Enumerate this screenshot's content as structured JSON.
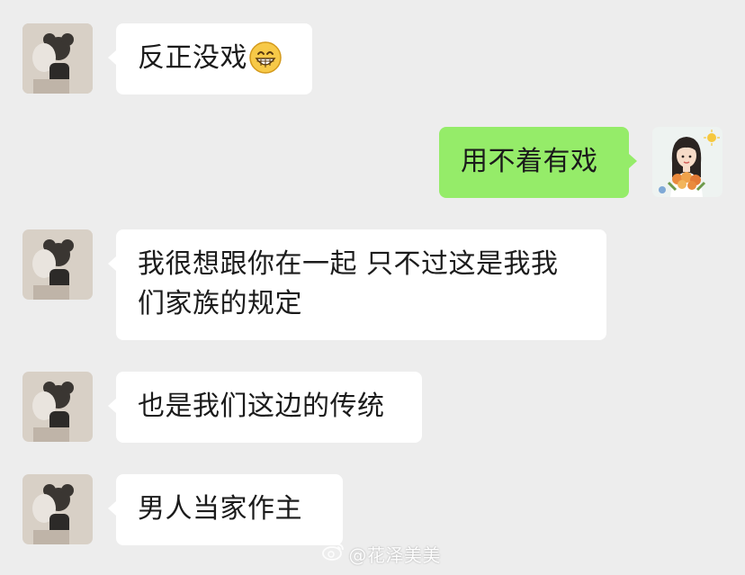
{
  "messages": [
    {
      "side": "left",
      "text": "反正没戏",
      "emoji": "grinning-face-emoji"
    },
    {
      "side": "right",
      "text": "用不着有戏"
    },
    {
      "side": "left",
      "text_line1": "我很想跟你在一起 只不过这是我我",
      "text_line2": "们家族的规定"
    },
    {
      "side": "left",
      "text": "也是我们这边的传统"
    },
    {
      "side": "left",
      "text": "男人当家作主"
    }
  ],
  "watermark": {
    "text": "@花泽美美",
    "icon": "weibo-icon"
  },
  "colors": {
    "background": "#ededed",
    "incoming_bubble": "#ffffff",
    "outgoing_bubble": "#95ec69",
    "text": "#1b1b1b"
  }
}
